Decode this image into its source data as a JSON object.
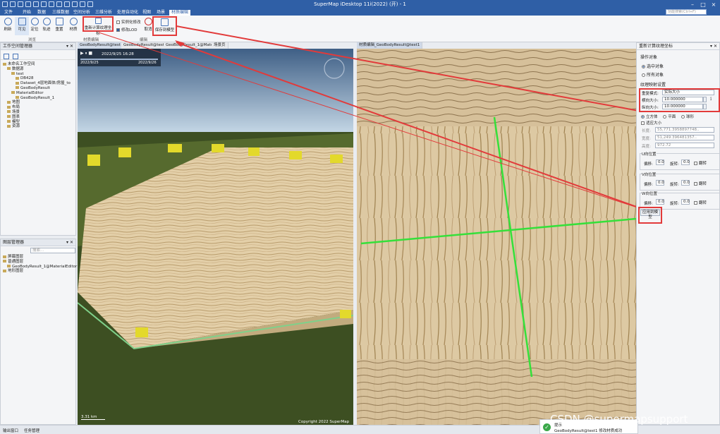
{
  "window": {
    "title": "SuperMap iDesktop 11i(2022) (开) - 1",
    "quick_icons": [
      "app-logo-icon",
      "new-icon",
      "open-icon",
      "save-icon",
      "undo-icon",
      "redo-icon",
      "copy-icon",
      "cut-icon",
      "paste-icon",
      "run-icon",
      "settings-icon",
      "help-icon"
    ]
  },
  "menu": {
    "items": [
      "文件",
      "开始",
      "数据",
      "三维数据",
      "空间分析",
      "三维分析",
      "处理自动化",
      "视图",
      "场景",
      "材质编辑"
    ],
    "active_index": 9,
    "search_placeholder": "功能搜索(Ctrl+F)"
  },
  "ribbon": {
    "buttons": [
      {
        "label": "刷新"
      },
      {
        "label": "可见"
      },
      {
        "label": "定位"
      },
      {
        "label": "轨迹"
      },
      {
        "label": "重置"
      },
      {
        "label": "材质"
      },
      {
        "label": "重新计算纹理坐标"
      }
    ],
    "checkboxes": [
      {
        "label": "实例化修改",
        "checked": false
      },
      {
        "label": "修改LOD",
        "checked": true
      }
    ],
    "cancel_label": "取消",
    "save_label": "保存到模型",
    "group_labels": {
      "browse": "浏览",
      "material": "材质编辑",
      "edit": "编辑"
    }
  },
  "workspace": {
    "title": "工作空间管理器",
    "tree": [
      {
        "level": 0,
        "text": "未命名工作空间"
      },
      {
        "level": 1,
        "text": "数据源"
      },
      {
        "level": 2,
        "text": "test"
      },
      {
        "level": 3,
        "text": "DB428"
      },
      {
        "level": 3,
        "text": "Dataset_4层地面体/房屋_to"
      },
      {
        "level": 3,
        "text": "GeoBodyResult"
      },
      {
        "level": 2,
        "text": "MaterialEditor"
      },
      {
        "level": 3,
        "text": "GeoBodyResult_1"
      },
      {
        "level": 1,
        "text": "地图"
      },
      {
        "level": 1,
        "text": "布局"
      },
      {
        "level": 1,
        "text": "场景"
      },
      {
        "level": 1,
        "text": "图表"
      },
      {
        "level": 1,
        "text": "模型"
      },
      {
        "level": 1,
        "text": "资源"
      }
    ]
  },
  "layers": {
    "title": "图层管理器",
    "search_placeholder": "搜索...",
    "tree": [
      {
        "level": 0,
        "text": "屏幕图层"
      },
      {
        "level": 0,
        "text": "普通图层"
      },
      {
        "level": 1,
        "text": "GeoBodyResult_1@MaterialEditor"
      },
      {
        "level": 0,
        "text": "地形图层"
      }
    ]
  },
  "tabs": {
    "left": [
      "GeoBodyResult@test",
      "GeoBodyResult@test",
      "GeoBodyResult_1@Material...",
      "场景页"
    ],
    "right": [
      "材质编辑_GeoBodyResult@test1"
    ]
  },
  "scene": {
    "time_start": "2022/9/25",
    "time_end": "2022/9/26",
    "time_current": "2022/9/25 16:28",
    "copyright": "Copyright 2022 SuperMap",
    "scale": "3.31 km"
  },
  "recalc": {
    "title": "重新计算纹理坐标",
    "op_header": "操作对象",
    "op_options": [
      "选中对象",
      "所有对象"
    ],
    "op_selected": 0,
    "mapping_header": "纹理映射设置",
    "repeat_label": "重复模式:",
    "repeat_value": "实际大小",
    "h_label": "横向大小:",
    "h_value": "10.000000",
    "v_label": "纵向大小:",
    "v_value": "10.000000",
    "shapes": [
      "立方体",
      "平面",
      "球形"
    ],
    "shape_selected": 0,
    "fit_label": "适应大小",
    "len_label": "长度:",
    "len_value": "55,771.3958897748..",
    "wid_label": "宽度:",
    "wid_value": "51,249.396481357..",
    "hei_label": "高度:",
    "hei_value": "972.72",
    "u_header": "U向位置",
    "v_header": "V向位置",
    "w_header": "W向位置",
    "offset_label": "偏移:",
    "rotate_label": "旋转:",
    "flip_label": "翻转",
    "offset_value": "0.0",
    "rotate_value": "0.0",
    "apply_label": "应用到模型"
  },
  "status": {
    "left": "输出窗口",
    "left2": "任务管理"
  },
  "toast": {
    "title": "提示",
    "message": "GeoBodyResult@test1 修改材质成功"
  },
  "watermark": "CSDN @supermapsupport",
  "colors": {
    "accent": "#2f5fa6",
    "highlight": "#e23a3a",
    "green": "#35e03a"
  }
}
